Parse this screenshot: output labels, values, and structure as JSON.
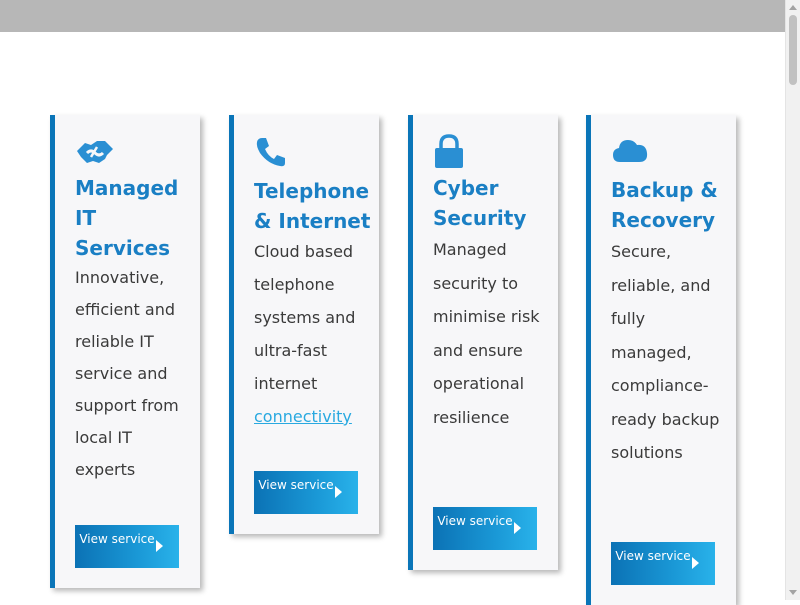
{
  "cards": [
    {
      "title": "Managed IT Services",
      "description": "Innovative, efficient and reliable IT service and support from local IT experts",
      "button": "View service",
      "icon": "handshake-icon"
    },
    {
      "title": "Telephone & Internet",
      "description_prefix": "Cloud based telephone systems and ultra-fast internet",
      "description_link": "connectivity",
      "button": "View service",
      "icon": "phone-icon"
    },
    {
      "title": "Cyber Security",
      "description": "Managed security to minimise risk and ensure operational resilience",
      "button": "View service",
      "icon": "lock-icon"
    },
    {
      "title": "Backup & Recovery",
      "description": "Secure, reliable, and fully managed, compliance-ready backup solutions",
      "button": "View service",
      "icon": "cloud-icon"
    }
  ],
  "colors": {
    "accent": "#1a7fc4",
    "border": "#0a75b8",
    "link": "#29a9e0",
    "card_bg": "#f7f7f9"
  }
}
